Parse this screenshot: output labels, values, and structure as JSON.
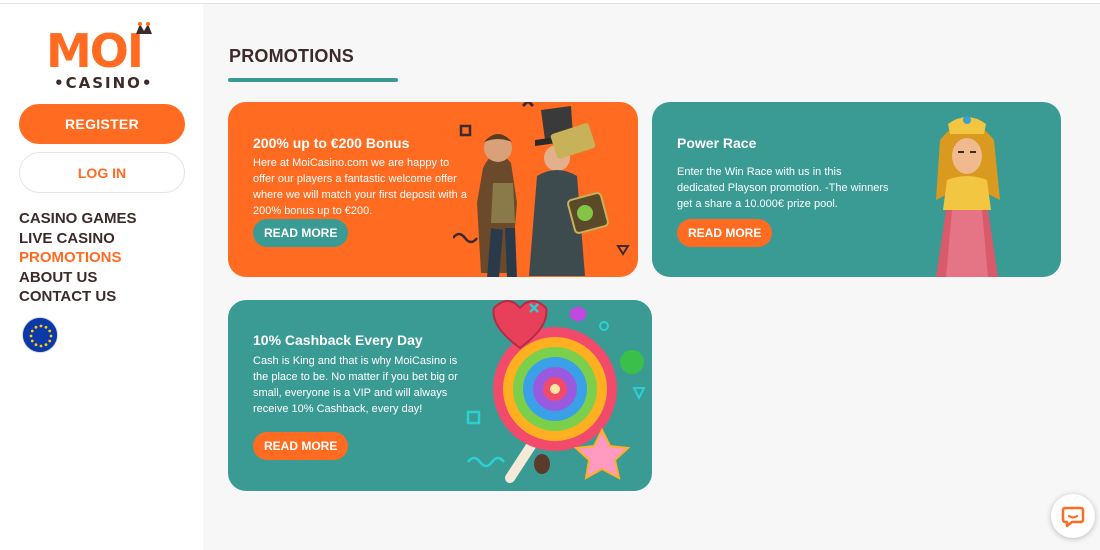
{
  "brand": {
    "name": "MOI",
    "sub": "CASINO",
    "accent": "#ff6b21",
    "teal": "#3a9b95",
    "dark": "#3d2b2b"
  },
  "sidebar": {
    "register_label": "REGISTER",
    "login_label": "LOG IN",
    "nav": [
      {
        "label": "CASINO GAMES",
        "active": false
      },
      {
        "label": "LIVE CASINO",
        "active": false
      },
      {
        "label": "PROMOTIONS",
        "active": true
      },
      {
        "label": "ABOUT US",
        "active": false
      },
      {
        "label": "CONTACT US",
        "active": false
      }
    ],
    "language_icon": "eu-flag-icon"
  },
  "main": {
    "title": "PROMOTIONS",
    "promotions": [
      {
        "title": "200% up to €200 Bonus",
        "text": "Here at MoiCasino.com we are happy to offer our players a fantastic welcome offer where we will match your first deposit with a 200% bonus up to €200.",
        "button": "READ MORE"
      },
      {
        "title": "Power Race",
        "text": "Enter the Win Race with us in this dedicated Playson promotion. -The winners get a share a 10.000€ prize pool.",
        "button": "READ MORE"
      },
      {
        "title": "10% Cashback Every Day",
        "text": "Cash is King and that is why MoiCasino is the place to be. No matter if you bet big or small, everyone is a VIP and will always receive 10% Cashback, every day!",
        "button": "READ MORE"
      }
    ]
  },
  "chat": {
    "icon": "chat-bubble-icon"
  }
}
